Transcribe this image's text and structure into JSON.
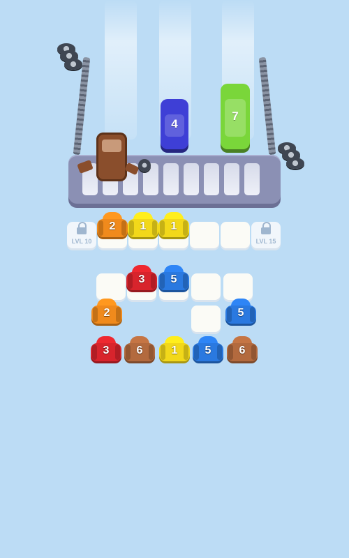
{
  "colors": {
    "background": "#bcdcf5",
    "orange": "#f08a1c",
    "yellow": "#f2d81a",
    "red": "#d8242c",
    "blue": "#2a79e0",
    "brown": "#b36a3e",
    "green": "#7ad63a",
    "navy_car": "#3e3fd6"
  },
  "parking": {
    "cars": [
      {
        "label": "4",
        "color": "#3e3fd6"
      },
      {
        "label": "7",
        "color": "#7ad63a"
      }
    ],
    "wreck_icon": "crashed-car-icon"
  },
  "holding_row": {
    "left_lock": {
      "label": "LVL 10",
      "icon": "lock-icon"
    },
    "right_lock": {
      "label": "LVL 15",
      "icon": "lock-icon"
    },
    "passengers": [
      {
        "label": "2",
        "color": "#f08a1c"
      },
      {
        "label": "1",
        "color": "#f2d81a"
      },
      {
        "label": "1",
        "color": "#f2d81a"
      }
    ]
  },
  "grid": {
    "row1": [
      {
        "label": "3",
        "color": "#d8242c"
      },
      {
        "label": "5",
        "color": "#2a79e0"
      }
    ],
    "row2": [
      {
        "label": "2",
        "color": "#f08a1c"
      },
      {
        "label": "5",
        "color": "#2a79e0"
      }
    ],
    "row3": [
      {
        "label": "3",
        "color": "#d8242c"
      },
      {
        "label": "6",
        "color": "#b36a3e"
      },
      {
        "label": "1",
        "color": "#f2d81a"
      },
      {
        "label": "5",
        "color": "#2a79e0"
      },
      {
        "label": "6",
        "color": "#b36a3e"
      }
    ]
  }
}
